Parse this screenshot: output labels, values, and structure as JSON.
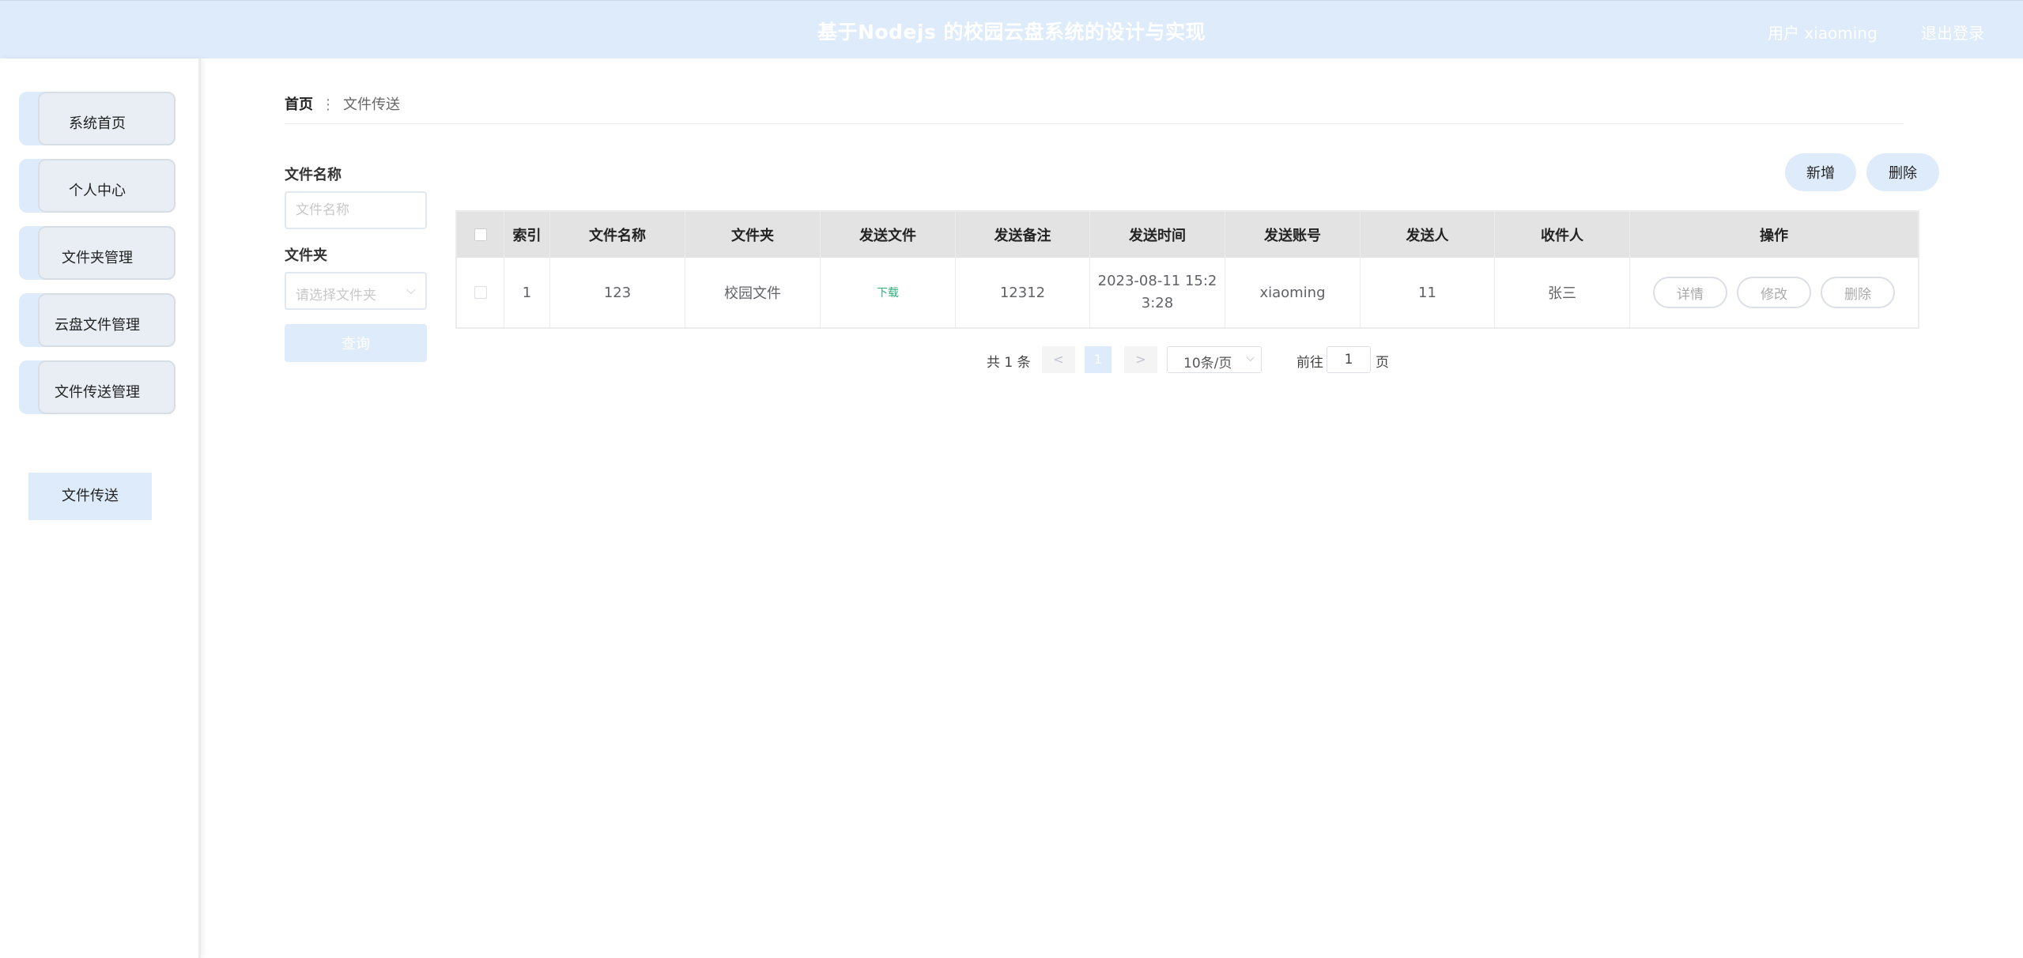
{
  "header": {
    "title": "基于Nodejs 的校园云盘系统的设计与实现",
    "user": "用户 xiaoming",
    "logout": "退出登录"
  },
  "sidebar": {
    "items": [
      {
        "label": "系统首页"
      },
      {
        "label": "个人中心"
      },
      {
        "label": "文件夹管理"
      },
      {
        "label": "云盘文件管理"
      },
      {
        "label": "文件传送管理"
      }
    ],
    "submenu": {
      "label": "文件传送"
    }
  },
  "breadcrumb": {
    "home": "首页",
    "separator": "⋮",
    "current": "文件传送"
  },
  "filters": {
    "name_label": "文件名称",
    "name_placeholder": "文件名称",
    "folder_label": "文件夹",
    "folder_placeholder": "请选择文件夹",
    "search_label": "查询"
  },
  "toolbar": {
    "add_label": "新增",
    "delete_label": "删除"
  },
  "table": {
    "columns": [
      "索引",
      "文件名称",
      "文件夹",
      "发送文件",
      "发送备注",
      "发送时间",
      "发送账号",
      "发送人",
      "收件人",
      "操作"
    ],
    "rows": [
      {
        "index": "1",
        "name": "123",
        "folder": "校园文件",
        "file_link": "下载",
        "remark": "12312",
        "time_line1": "2023-08-11 15:2",
        "time_line2": "3:28",
        "account": "xiaoming",
        "sender": "11",
        "receiver": "张三",
        "actions": [
          "详情",
          "修改",
          "删除"
        ]
      }
    ]
  },
  "pagination": {
    "total": "共 1 条",
    "prev": "<",
    "current": "1",
    "next": ">",
    "page_size": "10条/页",
    "goto_label": "前往",
    "goto_value": "1",
    "page_unit": "页"
  },
  "colors": {
    "accent": "#deebfa",
    "header_text": "#ffffff",
    "download": "#2db37a"
  }
}
